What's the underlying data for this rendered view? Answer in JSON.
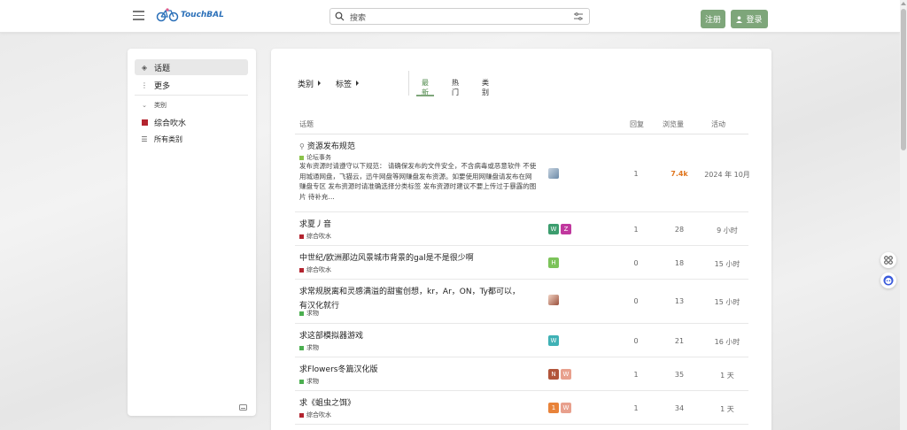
{
  "header": {
    "logo_text": "TouchBAL",
    "search_placeholder": "搜索",
    "register_label": "注册",
    "login_label": "登录",
    "accent_color": "#7ea67a"
  },
  "sidebar": {
    "topics_label": "话题",
    "more_label": "更多",
    "categories_header": "类别",
    "category_item": "综合吹水",
    "all_categories": "所有类别"
  },
  "nav": {
    "categories_drop": "类别",
    "tags_drop": "标签",
    "tab_latest": "最新",
    "tab_hot": "热门",
    "tab_categories": "类别"
  },
  "table": {
    "col_topic": "话题",
    "col_replies": "回复",
    "col_views": "浏览量",
    "col_activity": "活动",
    "rows": [
      {
        "title": "资源发布规范",
        "pinned": true,
        "category": "论坛事务",
        "category_color": "#8bc34a",
        "excerpt": "发布资源时请遵守以下规范： 请确保发布的文件安全，不含病毒或恶意软件 不使用城通网盘，飞猫云，迅牛网盘等网赚盘发布资源。如要使用网赚盘请发布在网赚盘专区 发布资源时请准确选择分类标签 发布资源时建议不要上传过于暴露的图片 待补充…",
        "avatars": [
          {
            "letter": "",
            "color": "#9fb3c8",
            "image": true
          }
        ],
        "replies": "1",
        "views": "7.4k",
        "views_hot": true,
        "activity": "2024 年 10月"
      },
      {
        "title": "求夏丿音",
        "category": "综合吹水",
        "category_color": "#b3242f",
        "avatars": [
          {
            "letter": "W",
            "color": "#3c9d6e"
          },
          {
            "letter": "Z",
            "color": "#c0389e"
          }
        ],
        "replies": "1",
        "views": "28",
        "activity": "9 小时"
      },
      {
        "title": "中世纪/欧洲那边风景城市背景的gal是不是很少啊",
        "category": "综合吹水",
        "category_color": "#b3242f",
        "avatars": [
          {
            "letter": "H",
            "color": "#7cc35a"
          }
        ],
        "replies": "0",
        "views": "18",
        "activity": "15 小时"
      },
      {
        "title": "求常规脱离和灵感满溢的甜蜜创想，kr，Ar，ON，Ty都可以，",
        "title2": "有汉化就行",
        "category": "求物",
        "category_color": "#4caf50",
        "avatars": [
          {
            "letter": "",
            "color": "#c98a6b",
            "image": true
          }
        ],
        "replies": "0",
        "views": "13",
        "activity": "15 小时"
      },
      {
        "title": "求这部模拟器游戏",
        "category": "求物",
        "category_color": "#4caf50",
        "avatars": [
          {
            "letter": "W",
            "color": "#3fb1b5"
          }
        ],
        "replies": "0",
        "views": "21",
        "activity": "16 小时"
      },
      {
        "title": "求Flowers冬篇汉化版",
        "category": "求物",
        "category_color": "#4caf50",
        "avatars": [
          {
            "letter": "N",
            "color": "#b2553a"
          },
          {
            "letter": "W",
            "color": "#e8a08d"
          }
        ],
        "replies": "1",
        "views": "35",
        "activity": "1 天"
      },
      {
        "title": "求《蛆虫之饵》",
        "category": "综合吹水",
        "category_color": "#b3242f",
        "avatars": [
          {
            "letter": "1",
            "color": "#e8833a"
          },
          {
            "letter": "W",
            "color": "#e8a08d"
          }
        ],
        "replies": "1",
        "views": "34",
        "activity": "1 天"
      }
    ]
  }
}
